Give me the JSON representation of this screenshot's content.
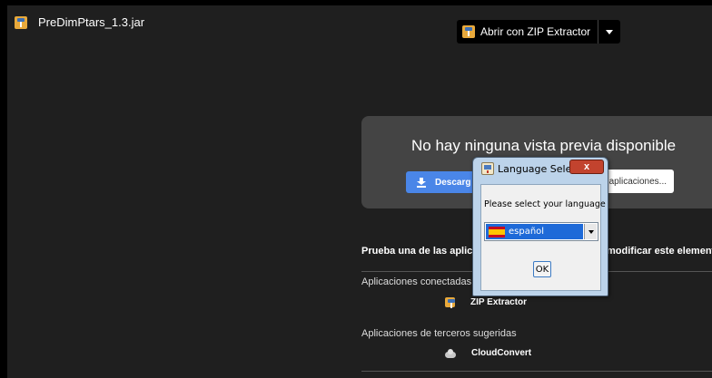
{
  "header": {
    "file_name": "PreDimPtars_1.3.jar",
    "open_with_label": "Abrir con ZIP Extractor"
  },
  "preview": {
    "message": "No hay ninguna vista previa disponible",
    "download_label": "Descarg",
    "apps_label": "aplicaciones..."
  },
  "suggestions": {
    "try_text_left": "Prueba una de las aplica",
    "try_text_right": "modificar este element",
    "connected_label": "Aplicaciones conectadas",
    "connected_apps": [
      "ZIP Extractor"
    ],
    "third_party_label": "Aplicaciones de terceros sugeridas",
    "third_party_apps": [
      "CloudConvert"
    ]
  },
  "dialog": {
    "title": "Language Sele...",
    "close_label": "x",
    "message": "Please select your language",
    "selected_language": "español",
    "ok_label": "OK"
  },
  "colors": {
    "background": "#1f1f1f",
    "card": "#444444",
    "download_blue": "#4a86e8",
    "selection_blue": "#1e6ad8"
  }
}
